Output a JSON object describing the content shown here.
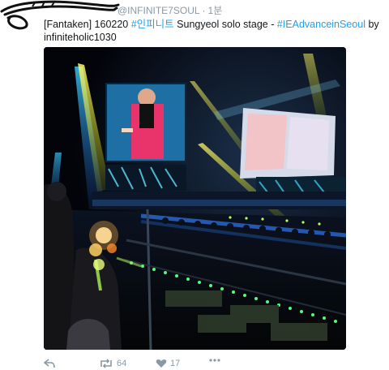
{
  "header": {
    "display_name": "INFINITE7SOUL",
    "handle": "@INFINITE7SOUL",
    "separator": "·",
    "time": "1분"
  },
  "tweet": {
    "prefix": "[Fantaken] 160220 ",
    "hashtag1": "#인피니트",
    "middle": " Sungyeol solo stage - ",
    "hashtag2": "#IEAdvanceinSeoul",
    "suffix": " by infiniteholic1030"
  },
  "media": {
    "icon": "concert-photo"
  },
  "actions": {
    "reply_icon": "reply-icon",
    "retweet_icon": "retweet-icon",
    "retweet_count": "64",
    "like_icon": "heart-icon",
    "like_count": "17",
    "more_icon": "more-icon"
  },
  "colors": {
    "link": "#1da1f2",
    "meta": "#8899a6",
    "text": "#14171a"
  }
}
